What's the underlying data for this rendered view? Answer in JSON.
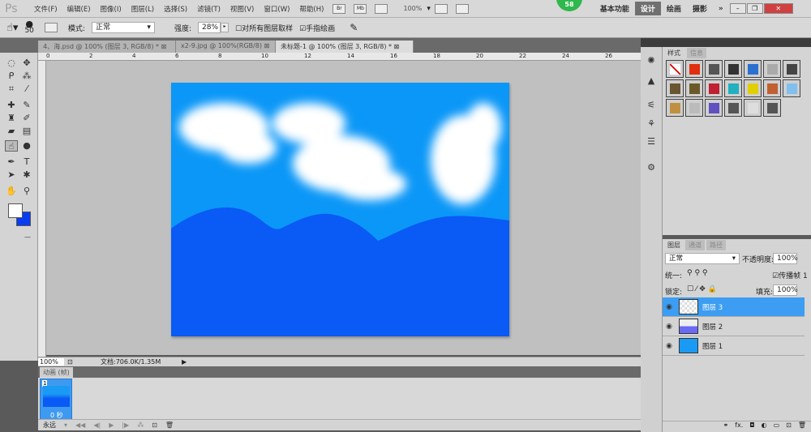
{
  "app": {
    "logo": "Ps",
    "notification_count": "58"
  },
  "menu": [
    "文件(F)",
    "编辑(E)",
    "图像(I)",
    "图层(L)",
    "选择(S)",
    "滤镜(T)",
    "视图(V)",
    "窗口(W)",
    "帮助(H)"
  ],
  "appbar": {
    "bridge": "Br",
    "minibridge": "Mb",
    "zoom": "100%"
  },
  "workspaces": [
    {
      "label": "基本功能",
      "active": false
    },
    {
      "label": "设计",
      "active": true
    },
    {
      "label": "绘画",
      "active": false
    },
    {
      "label": "摄影",
      "active": false
    },
    {
      "label": "»",
      "active": false
    }
  ],
  "window_controls": {
    "minimize": "–",
    "restore": "❐",
    "close": "✕"
  },
  "options": {
    "brush_size": "50",
    "mode_label": "模式:",
    "mode_value": "正常",
    "strength_label": "强度:",
    "strength_value": "28%",
    "sample_all_label": "对所有图层取样",
    "sample_all_checked": false,
    "finger_paint_label": "手指绘画",
    "finger_paint_checked": true
  },
  "doc_tabs": [
    {
      "label": "4、海.psd @ 100% (图层 3, RGB/8) *",
      "active": false
    },
    {
      "label": "x2-9.jpg @ 100%(RGB/8)",
      "active": false
    },
    {
      "label": "未标题-1 @ 100% (图层 3, RGB/8) *",
      "active": true
    }
  ],
  "ruler_ticks": [
    "0",
    "2",
    "4",
    "6",
    "8",
    "10",
    "12",
    "14",
    "16",
    "18",
    "20",
    "22",
    "24",
    "26"
  ],
  "status": {
    "zoom": "100%",
    "doc_info": "文档:706.0K/1.35M"
  },
  "animation": {
    "tab_label": "动画 (帧)",
    "frame_number": "1",
    "frame_delay": "0 秒",
    "loop": "永远"
  },
  "styles_panel": {
    "tabs": [
      "样式",
      "信息"
    ],
    "swatch_colors": [
      "#ffffff",
      "#e03010",
      "#555555",
      "#333333",
      "#2a70d0",
      "#aaaaaa",
      "#444444",
      "#6b5530",
      "#6b5a28",
      "#c02030",
      "#20b0c0",
      "#e0d000",
      "#c06030",
      "#80c0f0",
      "#c09040",
      "#bbbbbb",
      "#6050c0",
      "#555555",
      "#dddddd",
      "#555555"
    ]
  },
  "layers_panel": {
    "tabs": [
      "图层",
      "通道",
      "路径"
    ],
    "blend_mode": "正常",
    "opacity_label": "不透明度:",
    "opacity_value": "100%",
    "unify_label": "统一:",
    "propagate_label": "传播帧 1",
    "lock_label": "锁定:",
    "fill_label": "填充:",
    "fill_value": "100%",
    "layers": [
      {
        "name": "图层 3",
        "selected": true,
        "thumb": "transparent"
      },
      {
        "name": "图层 2",
        "selected": false,
        "thumb": "mountain"
      },
      {
        "name": "图层 1",
        "selected": false,
        "thumb": "blue"
      }
    ],
    "footer_icons": [
      "link",
      "fx",
      "mask",
      "adjustment",
      "group",
      "new",
      "delete"
    ],
    "footer_fx": "fx."
  },
  "colors": {
    "sky": "#0b97f7",
    "mountain": "#0a5af5",
    "accent": "#3c9df2"
  }
}
